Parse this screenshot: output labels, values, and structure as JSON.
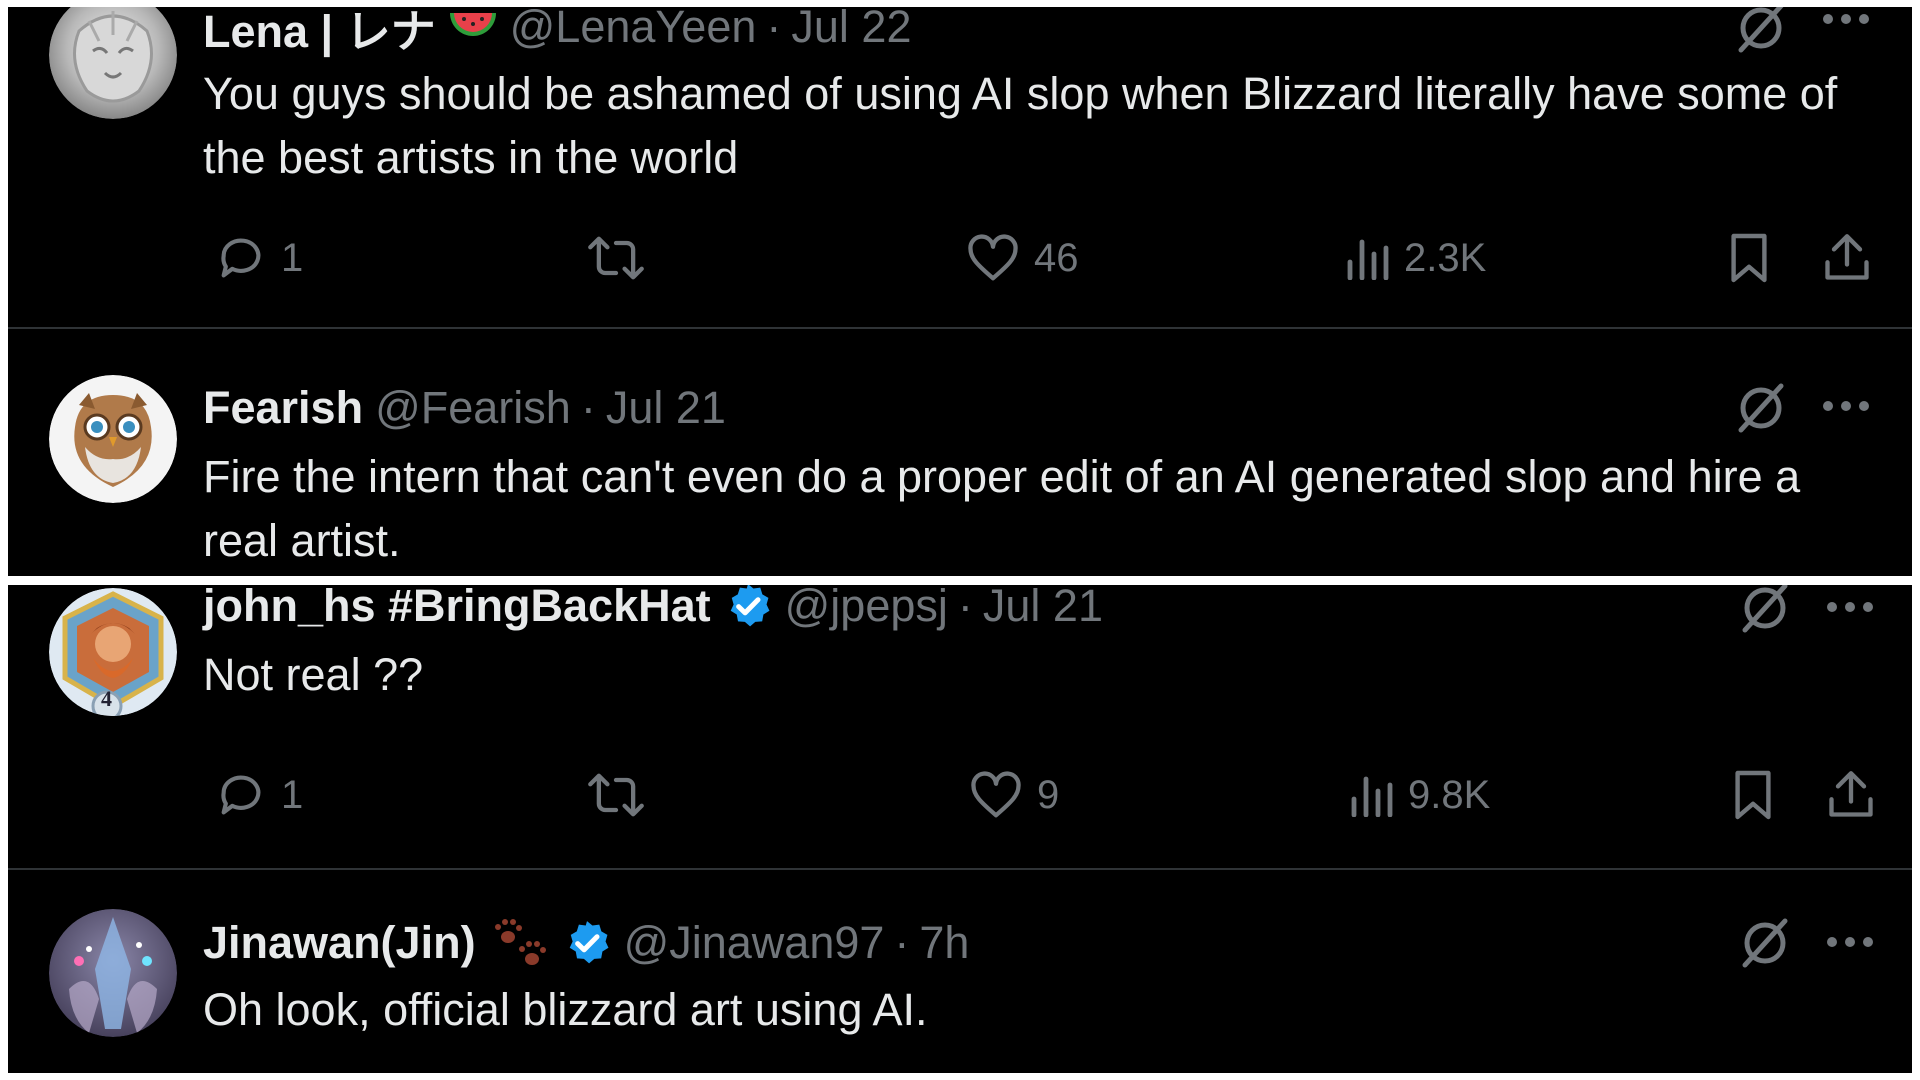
{
  "colors": {
    "background": "#000000",
    "primary_text": "#e7e9ea",
    "secondary_text": "#71767b",
    "divider": "#2f3336",
    "verified": "#1d9bf0"
  },
  "tweets": [
    {
      "name": "Lena | レナ",
      "emoji": "watermelon",
      "handle": "@LenaYeen",
      "separator": "·",
      "date": "Jul 22",
      "text": "You guys should be ashamed of using AI slop when Blizzard literally have some of the best artists in the world",
      "replies": "1",
      "reposts": "",
      "likes": "46",
      "views": "2.3K"
    },
    {
      "name": "Fearish",
      "handle": "@Fearish",
      "separator": "·",
      "date": "Jul 21",
      "text": "Fire the intern that can't even do a proper edit of an AI generated slop and hire a real artist."
    },
    {
      "name": "john_hs #BringBackHat",
      "verified": true,
      "handle": "@jpepsj",
      "separator": "·",
      "date": "Jul 21",
      "text": "Not real ??",
      "replies": "1",
      "reposts": "",
      "likes": "9",
      "views": "9.8K",
      "avatar_badge": "4"
    },
    {
      "name": "Jinawan(Jin)",
      "emoji": "paw-prints",
      "verified": true,
      "handle": "@Jinawan97",
      "separator": "·",
      "date": "7h",
      "text": "Oh look, official blizzard art using AI."
    }
  ],
  "icons": {
    "reply": "speech-bubble-icon",
    "repost": "repost-arrows-icon",
    "like": "heart-icon",
    "views": "bar-chart-icon",
    "bookmark": "bookmark-icon",
    "share": "share-upload-icon",
    "grok": "grok-slash-icon",
    "more": "more-dots-icon"
  }
}
